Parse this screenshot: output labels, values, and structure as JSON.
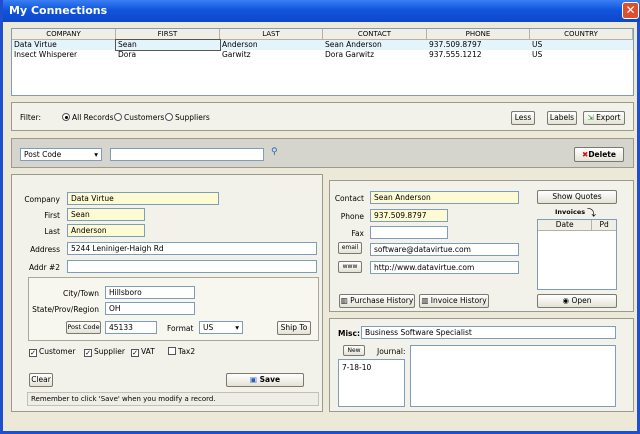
{
  "window": {
    "title": "My Connections"
  },
  "table": {
    "columns": [
      "COMPANY",
      "FIRST",
      "LAST",
      "CONTACT",
      "PHONE",
      "COUNTRY"
    ],
    "rows": [
      [
        "Data Virtue",
        "Sean",
        "Anderson",
        "Sean Anderson",
        "937.509.8797",
        "US"
      ],
      [
        "Insect Whisperer",
        "Dora",
        "Garwitz",
        "Dora Garwitz",
        "937.555.1212",
        "US"
      ]
    ]
  },
  "filter": {
    "label": "Filter:",
    "options": [
      "All Records",
      "Customers",
      "Suppliers"
    ],
    "selected": "All Records",
    "less": "Less",
    "labels": "Labels",
    "export": "Export"
  },
  "search": {
    "field": "Post Code",
    "value": "",
    "delete": "Delete"
  },
  "form": {
    "company_label": "Company",
    "company": "Data Virtue",
    "first_label": "First",
    "first": "Sean",
    "last_label": "Last",
    "last": "Anderson",
    "address_label": "Address",
    "address": "5244 Leniniger-Haigh Rd",
    "addr2_label": "Addr #2",
    "addr2": "",
    "city_label": "City/Town",
    "city": "Hillsboro",
    "state_label": "State/Prov/Region",
    "state": "OH",
    "postcode_btn": "Post Code",
    "postcode": "45133",
    "format_label": "Format",
    "format": "US",
    "shipto": "Ship To",
    "checks": [
      "Customer",
      "Supplier",
      "VAT",
      "Tax2"
    ],
    "clear": "Clear",
    "save": "Save",
    "reminder": "Remember to click 'Save' when you modify a record."
  },
  "contact": {
    "contact_label": "Contact",
    "contact": "Sean Anderson",
    "phone_label": "Phone",
    "phone": "937.509.8797",
    "fax_label": "Fax",
    "fax": "",
    "email_btn": "email",
    "email": "software@datavirtue.com",
    "www_btn": "www",
    "www": "http://www.datavirtue.com",
    "purchase_history": "Purchase History",
    "invoice_history": "Invoice History",
    "show_quotes": "Show Quotes",
    "invoices_label": "Invoices",
    "inv_cols": [
      "Date",
      "Pd"
    ],
    "open": "Open"
  },
  "misc": {
    "misc_label": "Misc:",
    "misc": "Business Software Specialist",
    "new": "New",
    "journal_label": "Journal:",
    "journal_entries": [
      "7-18-10"
    ]
  }
}
